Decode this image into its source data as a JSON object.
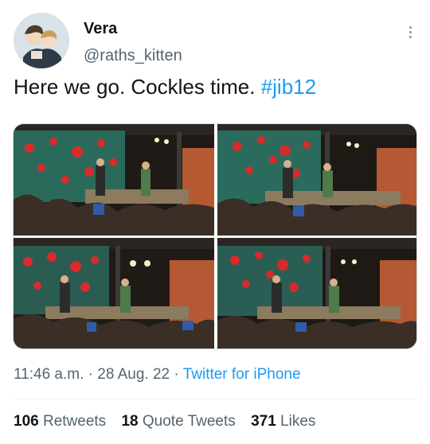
{
  "user": {
    "name": "Vera",
    "handle": "@raths_kitten"
  },
  "tweet": {
    "text": "Here we go. Cockles time.",
    "hashtag": "#jib12"
  },
  "media": {
    "count": 4
  },
  "meta": {
    "time": "11:46 a.m.",
    "separator": "·",
    "date": "28 Aug. 22",
    "source": "Twitter for iPhone"
  },
  "stats": {
    "retweets_count": "106",
    "retweets_label": "Retweets",
    "quote_count": "18",
    "quote_label": "Quote Tweets",
    "likes_count": "371",
    "likes_label": "Likes"
  },
  "colors": {
    "accent": "#1d9bf0",
    "secondary_text": "#536471",
    "primary_text": "#0f1419"
  }
}
